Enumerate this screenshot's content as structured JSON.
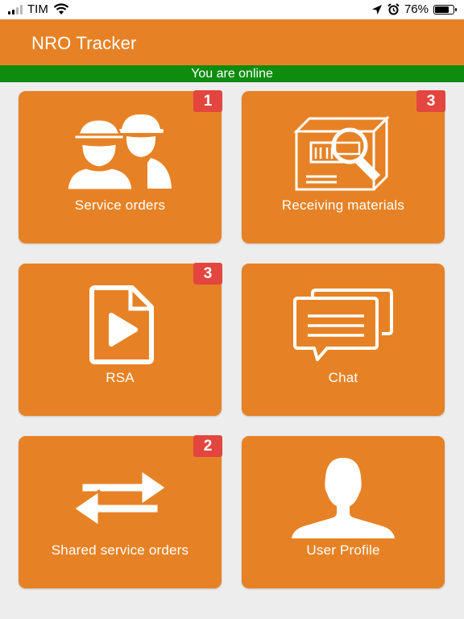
{
  "status_bar": {
    "carrier": "TIM",
    "battery_percent_text": "76%",
    "battery_level": 0.76,
    "icons": [
      "signal-icon",
      "wifi-icon",
      "location-arrow-icon",
      "alarm-icon",
      "battery-icon"
    ]
  },
  "app_bar": {
    "title": "NRO Tracker"
  },
  "connection_banner": {
    "text": "You are online",
    "color": "#0e8c0e"
  },
  "colors": {
    "accent": "#e68225",
    "badge": "#e2463f",
    "background": "#ededed"
  },
  "tiles": [
    {
      "label": "Service orders",
      "badge": "1",
      "icon": "workers-icon"
    },
    {
      "label": "Receiving materials",
      "badge": "3",
      "icon": "box-search-icon"
    },
    {
      "label": "RSA",
      "badge": "3",
      "icon": "video-file-icon"
    },
    {
      "label": "Chat",
      "badge": "",
      "icon": "chat-icon"
    },
    {
      "label": "Shared service orders",
      "badge": "2",
      "icon": "exchange-arrows-icon"
    },
    {
      "label": "User Profile",
      "badge": "",
      "icon": "user-icon"
    }
  ]
}
